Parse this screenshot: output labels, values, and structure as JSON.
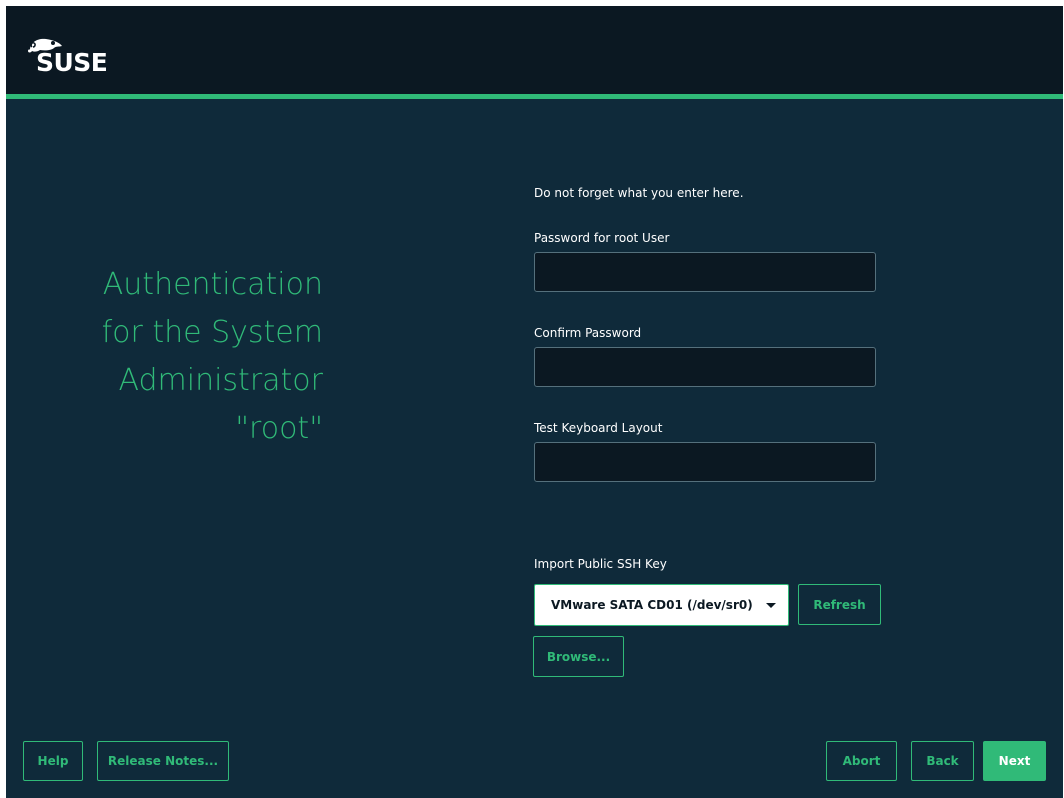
{
  "header": {
    "logo_text": "SUSE",
    "logo_icon": "suse-chameleon-icon",
    "accent_color": "#30ba78",
    "background_color": "#0b1822"
  },
  "title": {
    "lines": [
      "Authentication",
      "for the System",
      "Administrator",
      "\"root\""
    ]
  },
  "form": {
    "hint": "Do not forget what you enter here.",
    "password_label": "Password for root User",
    "password_value": "",
    "confirm_label": "Confirm Password",
    "confirm_value": "",
    "keyboard_label": "Test Keyboard Layout",
    "keyboard_value": ""
  },
  "ssh": {
    "label": "Import Public SSH Key",
    "selected": "VMware SATA CD01 (/dev/sr0)",
    "refresh_label": "Refresh",
    "browse_label": "Browse..."
  },
  "footer": {
    "help_label": "Help",
    "release_notes_label": "Release Notes...",
    "abort_label": "Abort",
    "back_label": "Back",
    "next_label": "Next"
  }
}
